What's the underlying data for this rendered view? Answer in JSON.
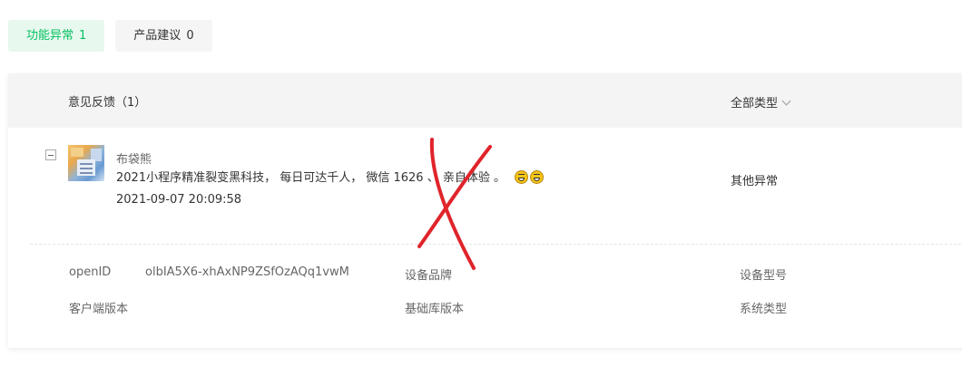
{
  "tabs": [
    {
      "label": "功能异常",
      "count": "1",
      "active": true
    },
    {
      "label": "产品建议",
      "count": "0",
      "active": false
    }
  ],
  "header": {
    "title": "意见反馈（1）",
    "type_filter": "全部类型",
    "type_filter_icon": "chevron-down-icon"
  },
  "feedback": {
    "user_name": "布袋熊",
    "message": "2021小程序精准裂变黑科技， 每日可达千人， 微信 1626 、 亲自体验 。",
    "emojis": [
      "grinning-face-icon",
      "laughing-face-icon"
    ],
    "timestamp": "2021-09-07 20:09:58",
    "category": "其他异常"
  },
  "details": {
    "openid_label": "openID",
    "openid_value": "olbIA5X6-xhAxNP9ZSfOzAQq1vwM",
    "device_brand_label": "设备品牌",
    "device_model_label": "设备型号",
    "client_version_label": "客户端版本",
    "base_lib_label": "基础库版本",
    "os_type_label": "系统类型"
  },
  "colors": {
    "accent": "#07c160",
    "accent_bg": "#e7f8ee",
    "header_bg": "#f4f4f5",
    "mark": "#e0242b"
  }
}
